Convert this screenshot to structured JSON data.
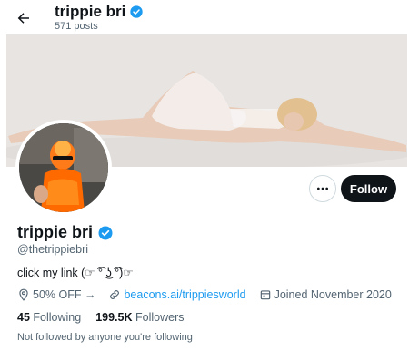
{
  "header": {
    "title": "trippie bri",
    "posts_count": "571 posts"
  },
  "profile": {
    "display_name": "trippie bri",
    "handle": "@thetrippiebri",
    "bio": "click my link (☞ ͡° ͜ʖ ͡°)☞",
    "location": "50% OFF →",
    "website": "beacons.ai/trippiesworld",
    "joined": "Joined November 2020",
    "following_count": "45",
    "following_label": "Following",
    "followers_count": "199.5K",
    "followers_label": "Followers",
    "follow_context": "Not followed by anyone you're following"
  },
  "actions": {
    "follow_label": "Follow"
  },
  "colors": {
    "accent": "#1d9bf0",
    "text": "#0f1419",
    "muted": "#536471",
    "follow_bg": "#0f1419"
  },
  "icons": [
    "back-arrow-icon",
    "verified-badge-icon",
    "more-icon",
    "location-icon",
    "link-icon",
    "calendar-icon"
  ]
}
